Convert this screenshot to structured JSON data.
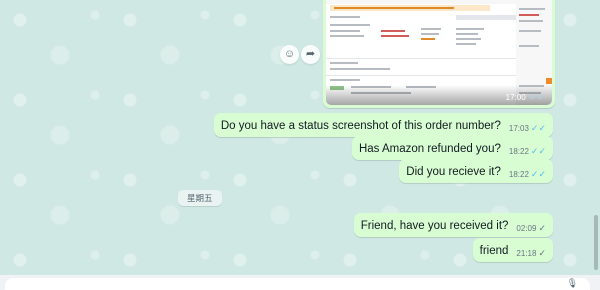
{
  "image_message": {
    "time": "17:00",
    "status": "read"
  },
  "actions": {
    "react_icon": "emoji-icon",
    "forward_icon": "forward-icon"
  },
  "messages": [
    {
      "text": "Do you have a status screenshot of this order number?",
      "time": "17:03",
      "status": "read"
    },
    {
      "text": "Has Amazon refunded you?",
      "time": "18:22",
      "status": "read"
    },
    {
      "text": "Did you recieve it?",
      "time": "18:22",
      "status": "read"
    },
    {
      "text": "Friend, have you received it?",
      "time": "02:09",
      "status": "sent"
    },
    {
      "text": "friend",
      "time": "21:18",
      "status": "sent"
    }
  ],
  "day_divider": "星期五",
  "colors": {
    "outgoing_bubble": "#d9fdd3",
    "read_tick": "#53bdeb",
    "chat_bg": "#cfe8e3"
  }
}
